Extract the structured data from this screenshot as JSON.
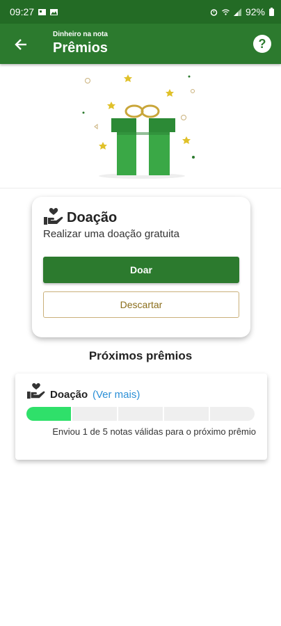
{
  "status_bar": {
    "time": "09:27",
    "battery": "92%"
  },
  "header": {
    "subtitle": "Dinheiro na nota",
    "title": "Prêmios",
    "help_symbol": "?"
  },
  "icons": {
    "back": "arrow-left-icon",
    "help": "help-circle-icon",
    "hand": "hand-heart-icon",
    "gift": "gift-icon"
  },
  "colors": {
    "primary": "#2c7a2e",
    "statusbar": "#236b25",
    "progress_fill": "#2fe06a",
    "link": "#2b8fd6",
    "secondary_border": "#c9b07a",
    "secondary_text": "#8a6d1a"
  },
  "reward_card": {
    "title": "Doação",
    "description": "Realizar uma doação gratuita",
    "primary_button": "Doar",
    "secondary_button": "Descartar"
  },
  "next_rewards": {
    "section_title": "Próximos prêmios",
    "items": [
      {
        "title": "Doação",
        "link": "(Ver mais)",
        "progress_segments": 5,
        "progress_completed": 1,
        "caption": "Enviou 1 de 5 notas válidas para o próximo prêmio"
      }
    ]
  }
}
